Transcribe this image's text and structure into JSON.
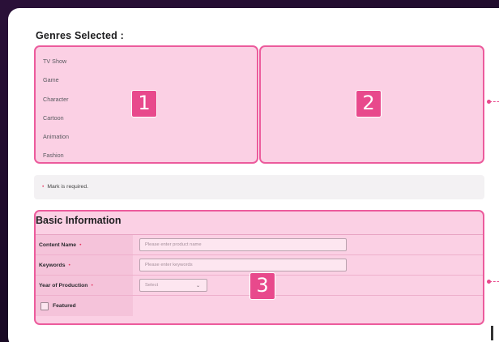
{
  "genres": {
    "title": "Genres Selected :",
    "items": [
      "TV Show",
      "Game",
      "Character",
      "Cartoon",
      "Animation",
      "Fashion"
    ]
  },
  "badges": {
    "one": "1",
    "two": "2",
    "three": "3"
  },
  "notice": {
    "star": "•",
    "text": "Mark is required."
  },
  "basic_info": {
    "title": "Basic Information",
    "content_name": {
      "label": "Content Name",
      "placeholder": "Please enter product name"
    },
    "keywords": {
      "label": "Keywords",
      "placeholder": "Please enter keywords"
    },
    "year": {
      "label": "Year of Production",
      "value": "Select"
    },
    "featured": {
      "label": "Featured"
    },
    "required_mark": "•"
  },
  "colors": {
    "highlight": "#fbd0e4",
    "highlight_border": "#ec5b9c",
    "badge": "#e8498c"
  }
}
